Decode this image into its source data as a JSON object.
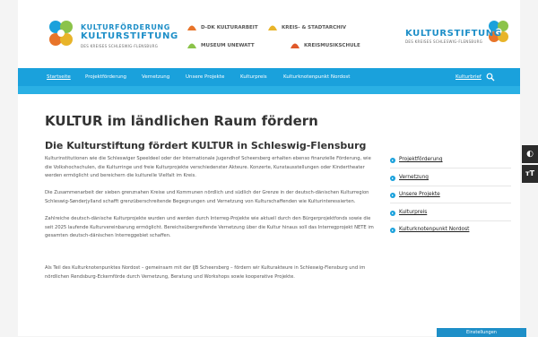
{
  "header": {
    "logo": {
      "line1": "KULTURFÖRDERUNG",
      "line2": "KULTURSTIFTUNG",
      "line3": "DES KREISES SCHLESWIG-FLENSBURG"
    },
    "partners": [
      {
        "label": "D-DK KULTURARBEIT",
        "color": "#e8742a"
      },
      {
        "label": "KREIS- & STADTARCHIV",
        "color": "#e8b42a"
      },
      {
        "label": "MUSEUM UNEWATT",
        "color": "#8bc34a"
      },
      {
        "label": "KREISMUSIKSCHULE",
        "color": "#e0592a"
      }
    ],
    "logo_right": {
      "line1": "KULTURSTIFTUNG",
      "line2": "DES KREISES SCHLESWIG-FLENSBURG"
    }
  },
  "nav": {
    "items": [
      "Startseite",
      "Projektförderung",
      "Vernetzung",
      "Unsere Projekte",
      "Kulturpreis",
      "Kulturknotenpunkt Nordost"
    ],
    "right_link": "Kulturbrief",
    "search_icon": "search-icon"
  },
  "main": {
    "title": "KULTUR im ländlichen Raum fördern",
    "subtitle": "Die Kulturstiftung fördert KULTUR in Schleswig-Flensburg",
    "paragraphs": [
      "Kulturinstitutionen wie die Schleswiger Speeldeel oder der Internationale Jugendhof Scheersberg erhalten ebenso finanzielle Förderung, wie die Volkshochschulen, die Kulturringe und freie Kulturprojekte verschiedenster Akteure. Konzerte, Kunstausstellungen oder Kindertheater werden ermöglicht und bereichern die kulturelle Vielfalt im Kreis.",
      "Die Zusammenarbeit der sieben grenznahen Kreise und Kommunen nördlich und südlich der Grenze in der deutsch-dänischen Kulturregion Schleswig-Sønderjylland schafft grenzüberschreitende Begegnungen und Vernetzung von Kulturschaffenden wie Kulturinteressierten.",
      "Zahlreiche deutsch-dänische Kulturprojekte wurden und werden durch Interreg-Projekte wie aktuell durch den Bürgerprojektfonds sowie die seit 2025 laufende Kulturvereinbarung ermöglicht. Bereichsübergreifende Vernetzung über die Kultur hinaus soll das Interregprojekt NETE im gesamten deutsch-dänischen Interreggebiet schaffen.",
      "Als Teil des Kulturknotenpunktes Nordost – gemeinsam mit der IJB Scheersberg – fördern wir Kulturakteure in Schleswig-Flensburg und im nördlichen Rendsburg-Eckernförde durch Vernetzung, Beratung und Workshops sowie kooperative Projekte."
    ]
  },
  "sidebar": {
    "links": [
      "Projektförderung",
      "Vernetzung",
      "Unsere Projekte",
      "Kulturpreis",
      "Kulturknotenpunkt Nordost"
    ]
  },
  "a11y": {
    "contrast_icon": "contrast-icon",
    "contrast_glyph": "◐",
    "font_icon": "font-size-icon",
    "font_glyph": "тT"
  },
  "consent": {
    "label": "Einstellungen"
  },
  "colors": {
    "accent": "#1aa1dc",
    "brand_blue": "#1e8fc8"
  }
}
